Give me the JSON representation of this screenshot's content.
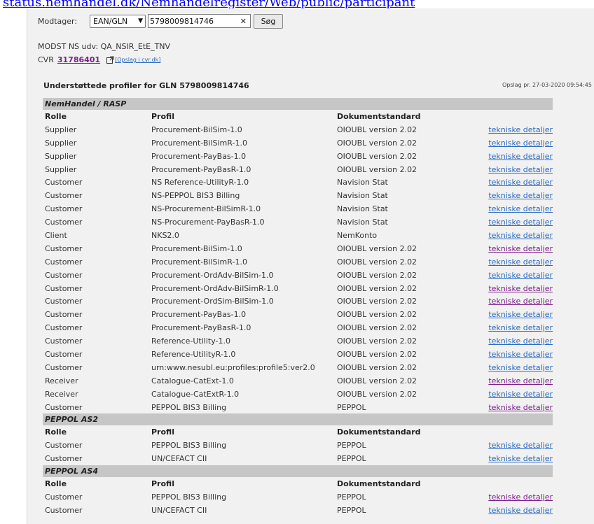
{
  "browser": {
    "top_link": "status.nemhandel.dk/Nemhandelregister/Web/public/participant"
  },
  "search": {
    "label": "Modtager:",
    "type_value": "EAN/GLN",
    "query_value": "5798009814746",
    "button_label": "Søg"
  },
  "receiver": {
    "name": "MODST NS udv: QA_NSIR_EtE_TNV",
    "cvr_label": "CVR",
    "cvr_number": "31786401",
    "cvr_lookup_link": "[Opslag i cvr.dk]"
  },
  "profiles_section": {
    "title": "Understøttede profiler for GLN 5798009814746",
    "lookup_time": "Opslag pr. 27-03-2020 09:54:45"
  },
  "table": {
    "columns": {
      "role": "Rolle",
      "profile": "Profil",
      "doc": "Dokumentstandard"
    },
    "link_label": "tekniske detaljer",
    "link_colors": {
      "default": "#2a6ac0",
      "visited": "#7b1e8a"
    }
  },
  "groups": [
    {
      "name": "NemHandel / RASP",
      "rows": [
        {
          "role": "Supplier",
          "profile": "Procurement-BilSim-1.0",
          "doc": "OIOUBL version 2.02",
          "visited": false
        },
        {
          "role": "Supplier",
          "profile": "Procurement-BilSimR-1.0",
          "doc": "OIOUBL version 2.02",
          "visited": false
        },
        {
          "role": "Supplier",
          "profile": "Procurement-PayBas-1.0",
          "doc": "OIOUBL version 2.02",
          "visited": false
        },
        {
          "role": "Supplier",
          "profile": "Procurement-PayBasR-1.0",
          "doc": "OIOUBL version 2.02",
          "visited": false
        },
        {
          "role": "Customer",
          "profile": "NS Reference-UtilityR-1.0",
          "doc": "Navision Stat",
          "visited": false
        },
        {
          "role": "Customer",
          "profile": "NS-PEPPOL BIS3 Billing",
          "doc": "Navision Stat",
          "visited": false
        },
        {
          "role": "Customer",
          "profile": "NS-Procurement-BilSimR-1.0",
          "doc": "Navision Stat",
          "visited": false
        },
        {
          "role": "Customer",
          "profile": "NS-Procurement-PayBasR-1.0",
          "doc": "Navision Stat",
          "visited": false
        },
        {
          "role": "Client",
          "profile": "NKS2.0",
          "doc": "NemKonto",
          "visited": false
        },
        {
          "role": "Customer",
          "profile": "Procurement-BilSim-1.0",
          "doc": "OIOUBL version 2.02",
          "visited": true
        },
        {
          "role": "Customer",
          "profile": "Procurement-BilSimR-1.0",
          "doc": "OIOUBL version 2.02",
          "visited": false
        },
        {
          "role": "Customer",
          "profile": "Procurement-OrdAdv-BilSim-1.0",
          "doc": "OIOUBL version 2.02",
          "visited": false
        },
        {
          "role": "Customer",
          "profile": "Procurement-OrdAdv-BilSimR-1.0",
          "doc": "OIOUBL version 2.02",
          "visited": true
        },
        {
          "role": "Customer",
          "profile": "Procurement-OrdSim-BilSim-1.0",
          "doc": "OIOUBL version 2.02",
          "visited": true
        },
        {
          "role": "Customer",
          "profile": "Procurement-PayBas-1.0",
          "doc": "OIOUBL version 2.02",
          "visited": false
        },
        {
          "role": "Customer",
          "profile": "Procurement-PayBasR-1.0",
          "doc": "OIOUBL version 2.02",
          "visited": false
        },
        {
          "role": "Customer",
          "profile": "Reference-Utility-1.0",
          "doc": "OIOUBL version 2.02",
          "visited": false
        },
        {
          "role": "Customer",
          "profile": "Reference-UtilityR-1.0",
          "doc": "OIOUBL version 2.02",
          "visited": false
        },
        {
          "role": "Customer",
          "profile": "urn:www.nesubl.eu:profiles:profile5:ver2.0",
          "doc": "OIOUBL version 2.02",
          "visited": false
        },
        {
          "role": "Receiver",
          "profile": "Catalogue-CatExt-1.0",
          "doc": "OIOUBL version 2.02",
          "visited": true
        },
        {
          "role": "Receiver",
          "profile": "Catalogue-CatExtR-1.0",
          "doc": "OIOUBL version 2.02",
          "visited": false
        },
        {
          "role": "Customer",
          "profile": "PEPPOL BIS3 Billing",
          "doc": "PEPPOL",
          "visited": true
        }
      ]
    },
    {
      "name": "PEPPOL AS2",
      "rows": [
        {
          "role": "Customer",
          "profile": "PEPPOL BIS3 Billing",
          "doc": "PEPPOL",
          "visited": false
        },
        {
          "role": "Customer",
          "profile": "UN/CEFACT CII",
          "doc": "PEPPOL",
          "visited": false
        }
      ]
    },
    {
      "name": "PEPPOL AS4",
      "rows": [
        {
          "role": "Customer",
          "profile": "PEPPOL BIS3 Billing",
          "doc": "PEPPOL",
          "visited": true
        },
        {
          "role": "Customer",
          "profile": "UN/CEFACT CII",
          "doc": "PEPPOL",
          "visited": false
        }
      ]
    }
  ]
}
